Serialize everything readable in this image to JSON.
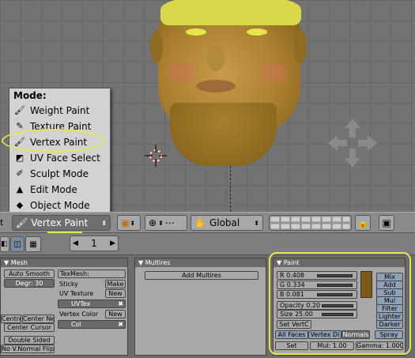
{
  "mode_menu": {
    "title": "Mode:",
    "items": [
      {
        "label": "Weight Paint",
        "icon": "weight-paint-icon"
      },
      {
        "label": "Texture Paint",
        "icon": "texture-paint-icon"
      },
      {
        "label": "Vertex Paint",
        "icon": "vertex-paint-icon"
      },
      {
        "label": "UV Face Select",
        "icon": "uv-face-select-icon"
      },
      {
        "label": "Sculpt Mode",
        "icon": "sculpt-mode-icon"
      },
      {
        "label": "Edit Mode",
        "icon": "edit-mode-icon"
      },
      {
        "label": "Object Mode",
        "icon": "object-mode-icon"
      }
    ]
  },
  "header": {
    "left_fragment": "t",
    "mode_selected": "Vertex Paint",
    "orientation": "Global"
  },
  "subbar": {
    "frame_value": "1"
  },
  "mesh_panel": {
    "title": "Mesh",
    "auto_smooth": "Auto Smooth",
    "degr": "Degr: 30",
    "centre": "Centre",
    "center_new": "Center Ne",
    "center_cursor": "Center Cursor",
    "double_sided": "Double Sided",
    "no_v_normal_flip": "No V.Normal Flip",
    "texmesh": "TexMesh:",
    "sticky": "Sticky",
    "make": "Make",
    "uv_texture": "UV Texture",
    "new1": "New",
    "uvtex": "UVTex",
    "vertex_color": "Vertex Color",
    "new2": "New",
    "col": "Col"
  },
  "multires_panel": {
    "title": "Multires",
    "add_multires": "Add Multires"
  },
  "paint_panel": {
    "title": "Paint",
    "r": "R 0.408",
    "g": "G 0.334",
    "b": "B 0.081",
    "opacity": "Opacity 0.20",
    "size": "Size 25.00",
    "set_vertc": "Set VertC",
    "modes": [
      "Mix",
      "Add",
      "Sub",
      "Mul",
      "Filter",
      "Lighter",
      "Darker"
    ],
    "all_faces": "All Faces",
    "vertex_dist": "Vertex Di",
    "normals": "Normals",
    "spray": "Spray",
    "set": "Set",
    "mul": "Mul: 1.00",
    "gamma": "Gamma: 1.000",
    "color_swatch": "#7a5a1a",
    "values": {
      "r": 0.408,
      "g": 0.334,
      "b": 0.081,
      "opacity": 0.2
    }
  },
  "colors": {
    "highlight": "#e3e84a",
    "menu_bg": "#d2d2d2"
  }
}
